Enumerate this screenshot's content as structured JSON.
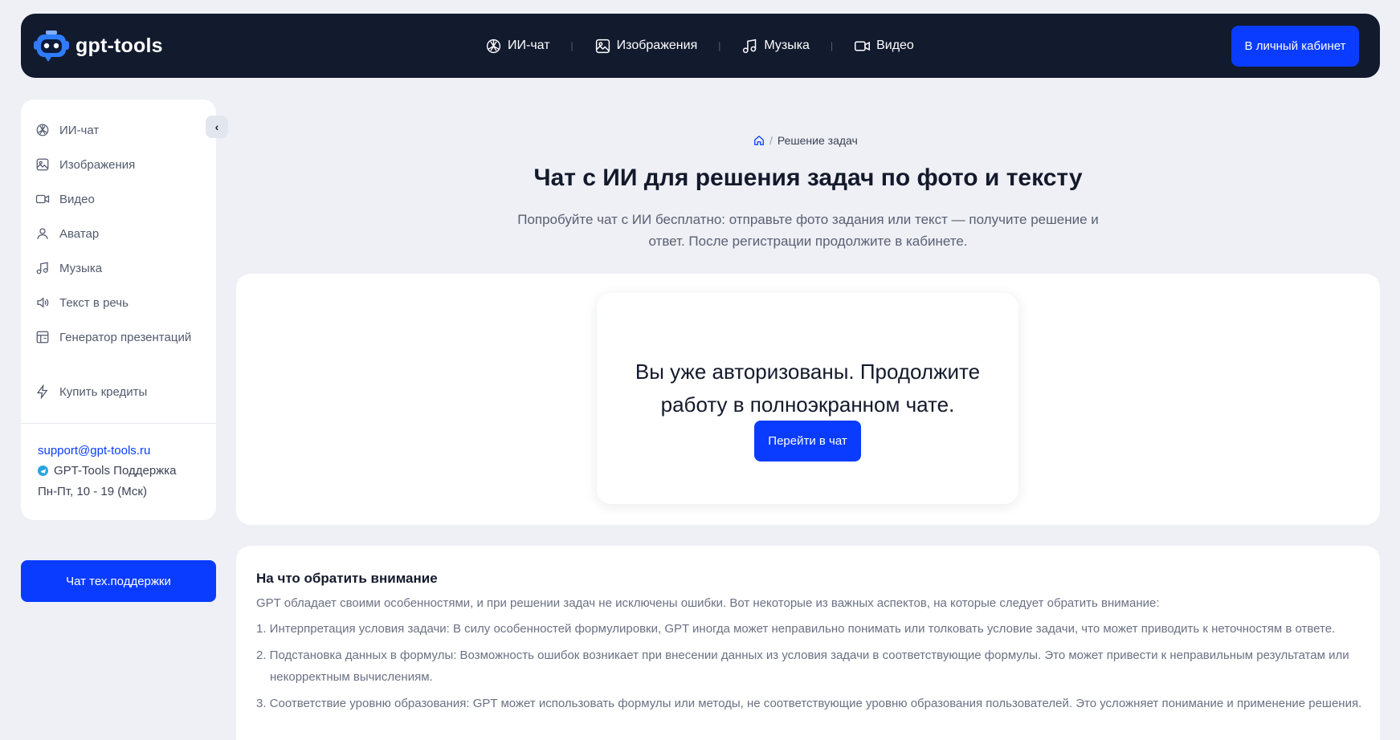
{
  "header": {
    "logo_text": "gpt-tools",
    "nav": [
      {
        "label": "ИИ-чат",
        "icon": "openai-icon"
      },
      {
        "label": "Изображения",
        "icon": "image-icon"
      },
      {
        "label": "Музыка",
        "icon": "music-icon"
      },
      {
        "label": "Видео",
        "icon": "video-icon"
      }
    ],
    "nav_separator": "|",
    "cabinet_button": "В личный кабинет"
  },
  "sidebar": {
    "collapse_glyph": "‹",
    "items": [
      {
        "label": "ИИ-чат",
        "icon": "openai-icon"
      },
      {
        "label": "Изображения",
        "icon": "image-icon"
      },
      {
        "label": "Видео",
        "icon": "video-icon"
      },
      {
        "label": "Аватар",
        "icon": "user-icon"
      },
      {
        "label": "Музыка",
        "icon": "music-icon"
      },
      {
        "label": "Текст в речь",
        "icon": "speaker-icon"
      },
      {
        "label": "Генератор презентаций",
        "icon": "presentation-icon"
      },
      {
        "label": "Купить кредиты",
        "icon": "lightning-icon"
      }
    ],
    "support_email": "support@gpt-tools.ru",
    "support_telegram": "GPT-Tools Поддержка",
    "support_hours": "Пн-Пт, 10 - 19 (Мск)"
  },
  "help_button": "Чат тех.поддержки",
  "breadcrumb": {
    "separator": "/",
    "current": "Решение задач"
  },
  "main": {
    "title": "Чат с ИИ для решения задач по фото и тексту",
    "subtitle": "Попробуйте чат с ИИ бесплатно: отправьте фото задания или текст — получите решение и ответ. После регистрации продолжите в кабинете.",
    "auth_line1": "Вы уже авторизованы. Продолжите",
    "auth_line2": "работу в полноэкранном чате.",
    "chat_button": "Перейти в чат"
  },
  "info": {
    "title": "На что обратить внимание",
    "intro": "GPT обладает своими особенностями, и при решении задач не исключены ошибки. Вот некоторые из важных аспектов, на которые следует обратить внимание:",
    "items": [
      "1. Интерпретация условия задачи: В силу особенностей формулировки, GPT иногда может неправильно понимать или толковать условие задачи, что может приводить к неточностям в ответе.",
      "2. Подстановка данных в формулы: Возможность ошибок возникает при внесении данных из условия задачи в соответствующие формулы. Это может привести к неправильным результатам или некорректным вычислениям.",
      "3. Соответствие уровню образования: GPT может использовать формулы или методы, не соответствующие уровню образования пользователей. Это усложняет понимание и применение решения."
    ]
  },
  "colors": {
    "accent": "#0a3cff",
    "header_bg": "#121a2e",
    "page_bg": "#eef0f5"
  }
}
